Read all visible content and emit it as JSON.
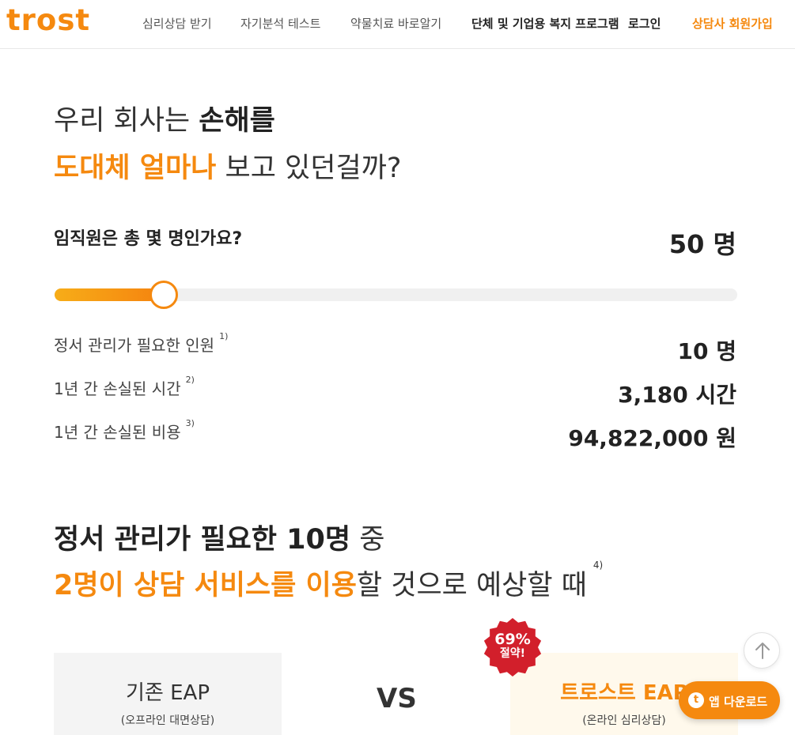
{
  "header": {
    "logo": "trost",
    "nav": {
      "counseling": "심리상담 받기",
      "self_test": "자기분석 테스트",
      "medication": "약물치료 바로알기",
      "corporate": "단체 및 기업용 복지 프로그램",
      "login": "로그인",
      "counselor_signup": "상담사 회원가입"
    }
  },
  "headline": {
    "line1_a": "우리 회사는 ",
    "line1_b": "손해를",
    "line2_a": "도대체 얼마나",
    "line2_b": " 보고 있던걸까?"
  },
  "calculator": {
    "question": "임직원은 총 몇 명인가요?",
    "employee_count": "50 명",
    "slider_fraction": 0.16,
    "stats": [
      {
        "label": "정서 관리가 필요한 인원",
        "note": "1)",
        "value": "10 명"
      },
      {
        "label": "1년 간 손실된 시간",
        "note": "2)",
        "value": "3,180 시간"
      },
      {
        "label": "1년 간 손실된 비용",
        "note": "3)",
        "value": "94,822,000 원"
      }
    ]
  },
  "section2": {
    "line1_a": "정서 관리가 필요한 10명",
    "line1_b": " 중",
    "line2_a": "2명이 상담 서비스를 이용",
    "line2_b": "할 것으로 예상할 때",
    "note": "4)"
  },
  "comparison": {
    "left_title": "기존 EAP",
    "left_sub": "(오프라인 대면상담)",
    "vs": "VS",
    "right_title": "트로스트 EAP",
    "right_sub": "(온라인 심리상담)",
    "badge_pct": "69%",
    "badge_word": "절약!"
  },
  "floating": {
    "app_icon_letter": "t",
    "app_download": "앱 다운로드"
  },
  "colors": {
    "accent": "#f5890f",
    "badge_red": "#d21f2b"
  }
}
